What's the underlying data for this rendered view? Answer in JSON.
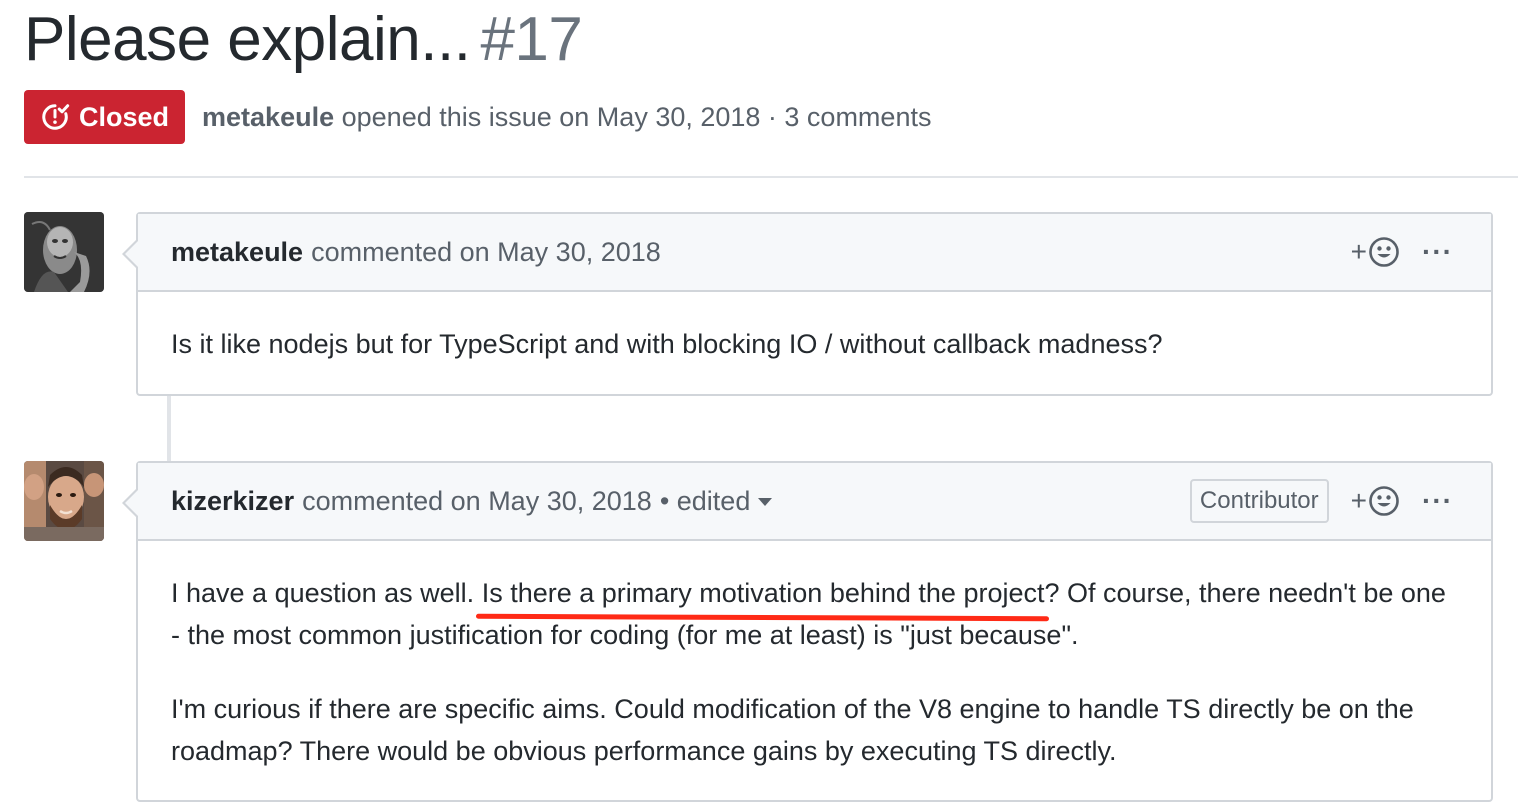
{
  "issue": {
    "title": "Please explain...",
    "number": "#17",
    "state": "Closed",
    "author": "metakeule",
    "meta": "opened this issue on May 30, 2018 · 3 comments"
  },
  "comments": [
    {
      "author": "metakeule",
      "action": "commented on May 30, 2018",
      "reaction_plus": "+",
      "more": "···",
      "body": "Is it like nodejs but for TypeScript and with blocking IO / without callback madness?"
    },
    {
      "author": "kizerkizer",
      "action": "commented on May 30, 2018",
      "edited": "• edited",
      "badge": "Contributor",
      "reaction_plus": "+",
      "more": "···",
      "body_p1_before": "I have a question as well.",
      "body_p1_underlined": "Is there a primary motivation behind the project",
      "body_p1_after": "? Of course, there needn't be one - the most common justification for coding (for me at least) is \"just because\".",
      "body_p2": "I'm curious if there are specific aims. Could modification of the V8 engine to handle TS directly be on the roadmap? There would be obvious performance gains by executing TS directly."
    }
  ],
  "colors": {
    "closed_badge": "#cb2431",
    "annotation_underline": "#ff2a16",
    "header_bg": "#f6f8fa",
    "border": "#d1d5da"
  },
  "icons": {
    "closed_state": "issue-closed-icon",
    "reaction": "smiley-icon",
    "more": "kebab-horizontal-icon"
  }
}
